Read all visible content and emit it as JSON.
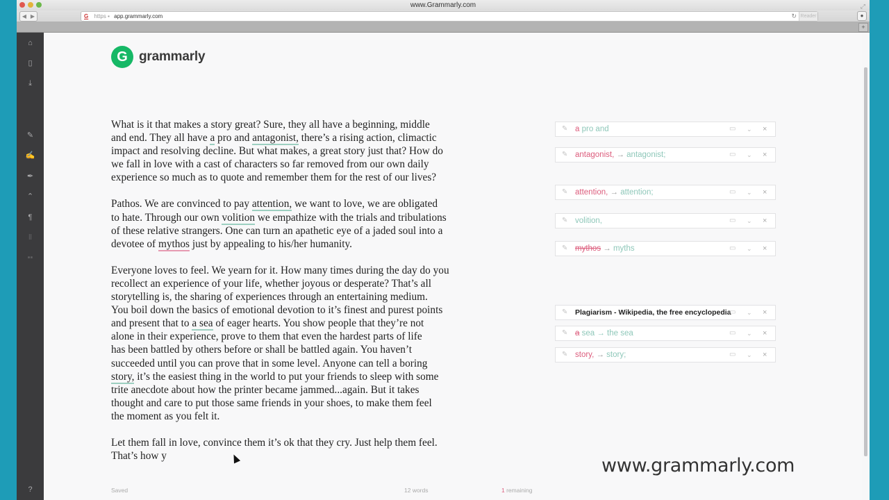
{
  "window": {
    "title": "www.Grammarly.com",
    "url_scheme": "https",
    "url": "app.grammarly.com",
    "reader_label": "Reader",
    "new_tab_label": "+"
  },
  "app": {
    "logo_letter": "G",
    "logo_text": "grammarly",
    "sidebar_top_icons": [
      "home-icon",
      "document-icon",
      "download-icon"
    ],
    "sidebar_tool_icons": [
      "pencil-icon",
      "pencil-lines-icon",
      "pen-nib-icon",
      "punctuation-icon",
      "paragraph-icon",
      "text-style-icon",
      "pause-icon"
    ],
    "sidebar_bottom_icon": "help-icon"
  },
  "document": {
    "paragraphs": [
      {
        "pre": "What is it that makes a story great? Sure, they all have a beginning, middle\nand end. They all have ",
        "mark1": "a",
        "mid1": " pro and ",
        "mark2": "antagonist,",
        "post": " there’s a rising action, climactic\nimpact and resolving decline. But what makes, a great story just that? How do\nwe fall in love with a cast of characters so far removed from our own daily\nexperience so much as to quote and remember them for the rest of our lives?"
      },
      {
        "pre": "Pathos. We are convinced to pay ",
        "mark1": "attention,",
        "mid1": " we want to love, we are obligated\nto hate. Through our own ",
        "mark2": "volition",
        "mid2": " we empathize with the trials and tribulations\nof these relative strangers. One can turn an apathetic eye of a jaded soul into a\ndevotee of ",
        "mark3": "mythos",
        "post": " just by appealing to his/her humanity."
      },
      {
        "pre": "Everyone loves to feel. We yearn for it. How many times during the day do you\nrecollect an experience of your life, whether joyous or desperate? That’s all\nstorytelling is, the sharing of experiences through an entertaining medium.\nYou boil down the basics of emotional devotion to it’s finest and purest points\nand present that to ",
        "mark1": "a sea",
        "mid1": " of eager hearts. You show people that they’re not\nalone in their experience, prove to them that even the hardest parts of life\nhas been battled by others before or shall be battled again. You haven’t\nsucceeded until you can prove that in some level. Anyone can tell a boring\n",
        "mark2": "story,",
        "post": " it’s the easiest thing in the world to put your friends to sleep with some\ntrite anecdote about how the printer became jammed...again. But it takes\nthought and care to put those same friends in your shoes, to make them feel\nthe moment as you felt it."
      },
      {
        "text": "Let them fall in love, convince them it’s ok that they cry. Just help them feel.\nThat’s how y"
      }
    ]
  },
  "suggestions": [
    {
      "bad": "a",
      "good": " pro and",
      "arrow": ""
    },
    {
      "bad": "antagonist,",
      "arrow": " → ",
      "good": "antagonist;"
    },
    {
      "bad": "attention,",
      "arrow": " → ",
      "good": "attention;"
    },
    {
      "bad": "",
      "arrow": "",
      "good": "volition,"
    },
    {
      "bad": "mythos",
      "arrow": " → ",
      "good": "myths"
    },
    {
      "title": "Plagiarism - Wikipedia, the free encyclopedia"
    },
    {
      "bad": "a",
      "good": " sea → the sea",
      "arrow": ""
    },
    {
      "bad": "story,",
      "arrow": " → ",
      "good": "story;"
    }
  ],
  "status": {
    "saved": "Saved",
    "word_count": "12 words",
    "remaining_num": "1",
    "remaining_label": " remaining"
  },
  "watermark": "www.grammarly.com",
  "colors": {
    "brand_green": "#16b866",
    "error_red": "#dc5c7c",
    "fix_green": "#8ec7b9",
    "sidebar": "#3b3b3d",
    "desktop": "#1e9cb7"
  }
}
